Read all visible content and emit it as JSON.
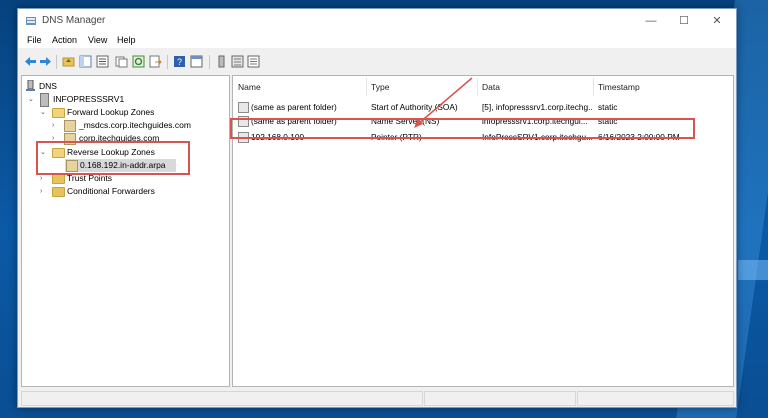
{
  "window": {
    "title": "DNS Manager",
    "controls": {
      "minimize": "—",
      "maximize": "☐",
      "close": "✕"
    }
  },
  "menu": [
    "File",
    "Action",
    "View",
    "Help"
  ],
  "tree": {
    "root": "DNS",
    "server": "INFOPRESSSRV1",
    "forward_zones": "Forward Lookup Zones",
    "forward_children": [
      "_msdcs.corp.itechguides.com",
      "corp.itechguides.com"
    ],
    "reverse_zones": "Reverse Lookup Zones",
    "reverse_children": [
      "0.168.192.in-addr.arpa"
    ],
    "trust_points": "Trust Points",
    "conditional_forwarders": "Conditional Forwarders"
  },
  "list": {
    "columns": [
      "Name",
      "Type",
      "Data",
      "Timestamp"
    ],
    "rows": [
      {
        "name": "(same as parent folder)",
        "type": "Start of Authority (SOA)",
        "data": "[5], infopresssrv1.corp.itechg...",
        "timestamp": "static"
      },
      {
        "name": "(same as parent folder)",
        "type": "Name Server (NS)",
        "data": "infopresssrv1.corp.itechgui...",
        "timestamp": "static"
      },
      {
        "name": "192.168.0.100",
        "type": "Pointer (PTR)",
        "data": "InfoPressSRV1.corp.itechgu...",
        "timestamp": "6/16/2023 2:00:00 PM"
      }
    ]
  },
  "colors": {
    "highlight": "#d9534f",
    "folder": "#e8c25a",
    "selection": "#d9d9d9"
  },
  "icons": [
    "back-arrow-icon",
    "forward-arrow-icon",
    "folder-up-icon",
    "show-tree-icon",
    "copy-icon",
    "refresh-icon",
    "export-icon",
    "help-icon",
    "properties-icon",
    "server-icon",
    "zone-icon",
    "list-icon"
  ]
}
